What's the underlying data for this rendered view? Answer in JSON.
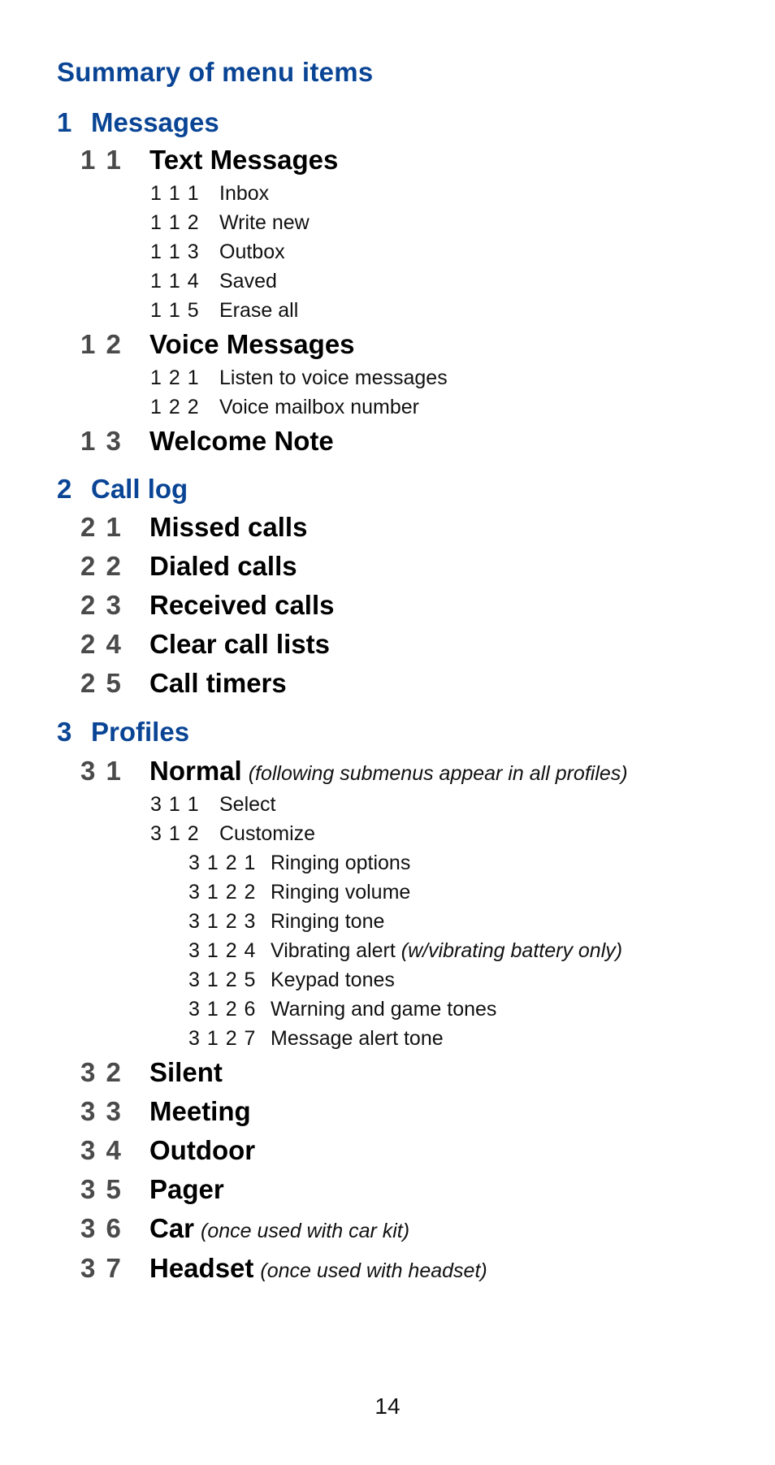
{
  "page": {
    "title": "Summary of menu items",
    "page_number": "14",
    "colors": {
      "section_heading": "#0a4595",
      "number_gray": "#4a4a4a",
      "text": "#111111"
    }
  },
  "menu": {
    "s1": {
      "num": "1",
      "label": "Messages",
      "i1": {
        "num": "1 1",
        "label": "Text Messages",
        "sub": [
          {
            "num": "1 1 1",
            "label": "Inbox"
          },
          {
            "num": "1 1 2",
            "label": "Write new"
          },
          {
            "num": "1 1 3",
            "label": "Outbox"
          },
          {
            "num": "1 1 4",
            "label": "Saved"
          },
          {
            "num": "1 1 5",
            "label": "Erase all"
          }
        ]
      },
      "i2": {
        "num": "1 2",
        "label": "Voice Messages",
        "sub": [
          {
            "num": "1 2 1",
            "label": "Listen to voice messages"
          },
          {
            "num": "1 2 2",
            "label": "Voice mailbox number"
          }
        ]
      },
      "i3": {
        "num": "1 3",
        "label": "Welcome Note"
      }
    },
    "s2": {
      "num": "2",
      "label": "Call log",
      "items": [
        {
          "num": "2 1",
          "label": "Missed calls"
        },
        {
          "num": "2 2",
          "label": "Dialed calls"
        },
        {
          "num": "2 3",
          "label": "Received calls"
        },
        {
          "num": "2 4",
          "label": "Clear call lists"
        },
        {
          "num": "2 5",
          "label": "Call timers"
        }
      ]
    },
    "s3": {
      "num": "3",
      "label": "Profiles",
      "normal": {
        "num": "3 1",
        "label": "Normal",
        "note": "(following submenus appear in all profiles)",
        "sub": [
          {
            "num": "3 1 1",
            "label": "Select"
          },
          {
            "num": "3 1 2",
            "label": "Customize"
          }
        ],
        "customize": [
          {
            "num": "3 1 2 1",
            "label": "Ringing options",
            "note": ""
          },
          {
            "num": "3 1 2 2",
            "label": "Ringing volume",
            "note": ""
          },
          {
            "num": "3 1 2 3",
            "label": "Ringing tone",
            "note": ""
          },
          {
            "num": "3 1 2 4",
            "label": "Vibrating alert",
            "note": "(w/vibrating battery only)"
          },
          {
            "num": "3 1 2 5",
            "label": "Keypad tones",
            "note": ""
          },
          {
            "num": "3 1 2 6",
            "label": "Warning and game tones",
            "note": ""
          },
          {
            "num": "3 1 2 7",
            "label": "Message alert tone",
            "note": ""
          }
        ]
      },
      "items": [
        {
          "num": "3 2",
          "label": "Silent",
          "note": ""
        },
        {
          "num": "3 3",
          "label": "Meeting",
          "note": ""
        },
        {
          "num": "3 4",
          "label": "Outdoor",
          "note": ""
        },
        {
          "num": "3 5",
          "label": "Pager",
          "note": ""
        },
        {
          "num": "3 6",
          "label": "Car",
          "note": "(once used with car kit)"
        },
        {
          "num": "3 7",
          "label": "Headset",
          "note": "(once used with headset)"
        }
      ]
    }
  }
}
